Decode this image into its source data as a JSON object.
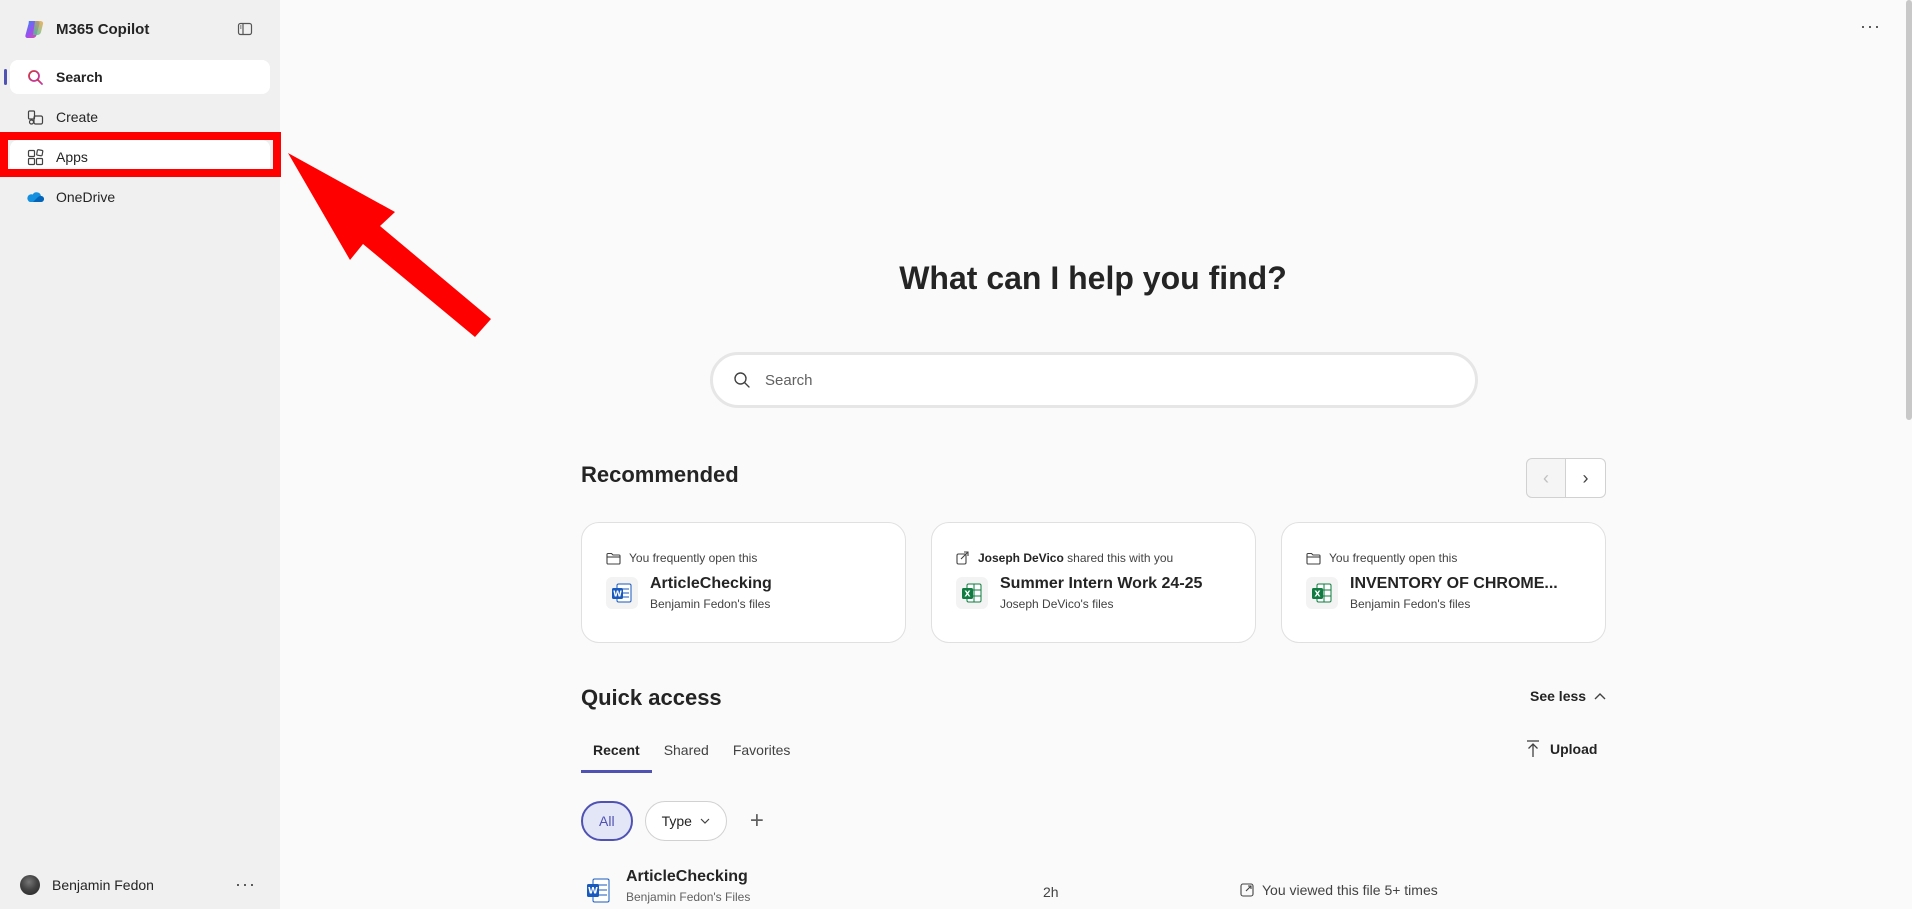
{
  "app": {
    "name": "M365 Copilot"
  },
  "sidebar": {
    "items": [
      {
        "label": "Search",
        "icon": "search-icon"
      },
      {
        "label": "Create",
        "icon": "create-icon"
      },
      {
        "label": "Apps",
        "icon": "apps-icon"
      },
      {
        "label": "OneDrive",
        "icon": "onedrive-icon"
      }
    ],
    "user": {
      "name": "Benjamin Fedon"
    }
  },
  "main": {
    "heading": "What can I help you find?",
    "search": {
      "placeholder": "Search",
      "value": ""
    },
    "recommended": {
      "title": "Recommended",
      "cards": [
        {
          "reason": "You frequently open this",
          "actor": "",
          "name": "ArticleChecking",
          "owner": "Benjamin Fedon's files",
          "filetype": "word"
        },
        {
          "reason": " shared this with you",
          "actor": "Joseph DeVico",
          "name": "Summer Intern Work 24-25",
          "owner": "Joseph DeVico's files",
          "filetype": "excel"
        },
        {
          "reason": "You frequently open this",
          "actor": "",
          "name": "INVENTORY OF CHROME...",
          "owner": "Benjamin Fedon's files",
          "filetype": "excel"
        }
      ]
    },
    "quick_access": {
      "title": "Quick access",
      "see_less": "See less",
      "tabs": [
        "Recent",
        "Shared",
        "Favorites"
      ],
      "upload": "Upload",
      "filters": {
        "all": "All",
        "type": "Type"
      },
      "rows": [
        {
          "name": "ArticleChecking",
          "location": "Benjamin Fedon's Files",
          "time": "2h",
          "activity": "You viewed this file 5+ times"
        }
      ]
    }
  },
  "colors": {
    "accent": "#4f52b2",
    "annotation": "#ff0000",
    "word": "#185abd",
    "excel": "#107c41"
  }
}
